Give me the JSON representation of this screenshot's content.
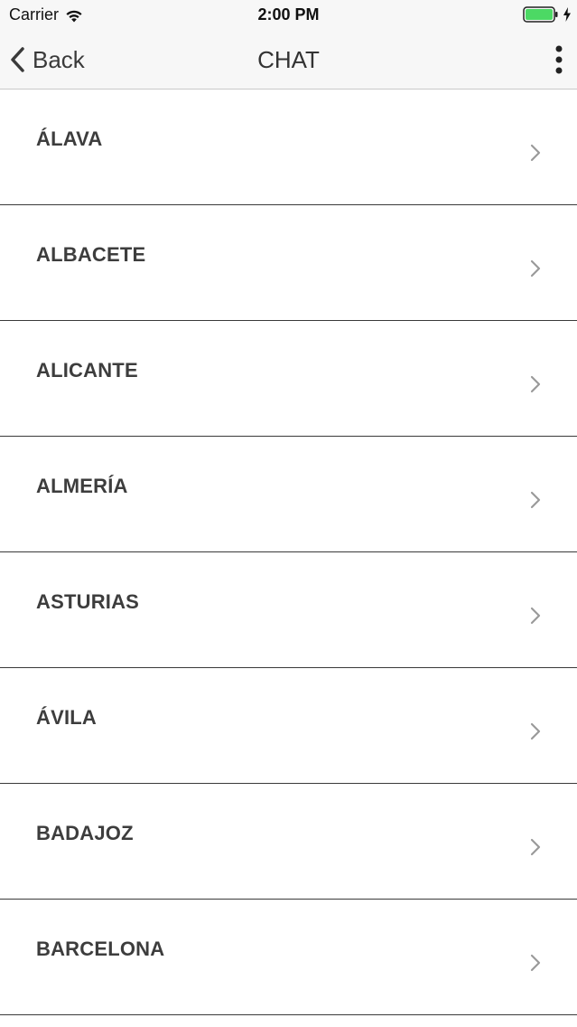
{
  "status_bar": {
    "carrier": "Carrier",
    "time": "2:00 PM",
    "wifi_icon": "wifi-icon",
    "battery_icon": "battery-icon",
    "battery_color": "#4cd964"
  },
  "nav": {
    "back_label": "Back",
    "title": "CHAT",
    "back_icon": "chevron-left-icon",
    "more_icon": "more-vertical-icon"
  },
  "list": {
    "items": [
      {
        "label": "ÁLAVA"
      },
      {
        "label": "ALBACETE"
      },
      {
        "label": "ALICANTE"
      },
      {
        "label": "ALMERÍA"
      },
      {
        "label": "ASTURIAS"
      },
      {
        "label": "ÁVILA"
      },
      {
        "label": "BADAJOZ"
      },
      {
        "label": "BARCELONA"
      }
    ],
    "row_icon": "chevron-right-icon"
  }
}
